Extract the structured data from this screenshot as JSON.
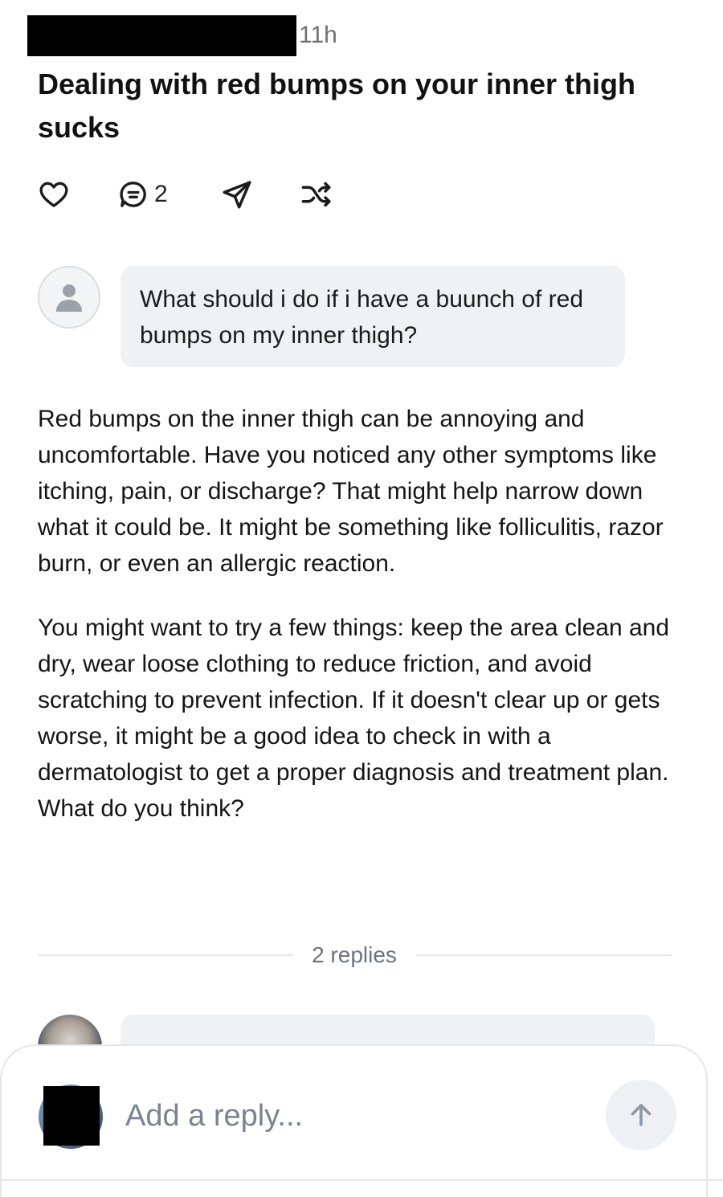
{
  "post": {
    "time": "11h",
    "title": "Dealing with red bumps on your inner thigh sucks",
    "comment_count": "2"
  },
  "icons": {
    "like": "heart-icon",
    "comment": "comment-icon",
    "share": "send-icon",
    "remix": "shuffle-icon"
  },
  "question": {
    "text": "What should i do if i have a buunch of red bumps on my inner thigh?"
  },
  "answer": {
    "paragraphs": [
      "Red bumps on the inner thigh can be annoying and uncomfortable. Have you noticed any other symptoms like itching, pain, or discharge? That might help narrow down what it could be. It might be something like folliculitis, razor burn, or even an allergic reaction.",
      "You might want to try a few things: keep the area clean and dry, wear loose clothing to reduce friction, and avoid scratching to prevent infection. If it doesn't clear up or gets worse, it might be a good idea to check in with a dermatologist to get a proper diagnosis and treatment plan. What do you think?"
    ]
  },
  "replies": {
    "label": "2 replies"
  },
  "compose": {
    "placeholder": "Add a reply..."
  },
  "colors": {
    "bubble_bg": "#eff1f5",
    "muted_text": "#6b7380",
    "redaction": "#000000"
  }
}
